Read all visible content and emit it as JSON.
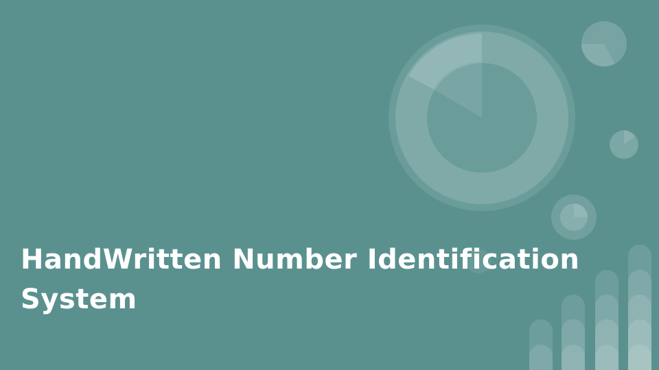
{
  "slide": {
    "title": "HandWritten Number Identification System"
  },
  "theme": {
    "background": "#5a918f",
    "title_color": "#ffffff",
    "decoration_color": "#ffffff"
  },
  "decorations": {
    "icons": [
      "donut-chart-icon",
      "pie-chart-icon",
      "bar-chart-icon"
    ]
  }
}
